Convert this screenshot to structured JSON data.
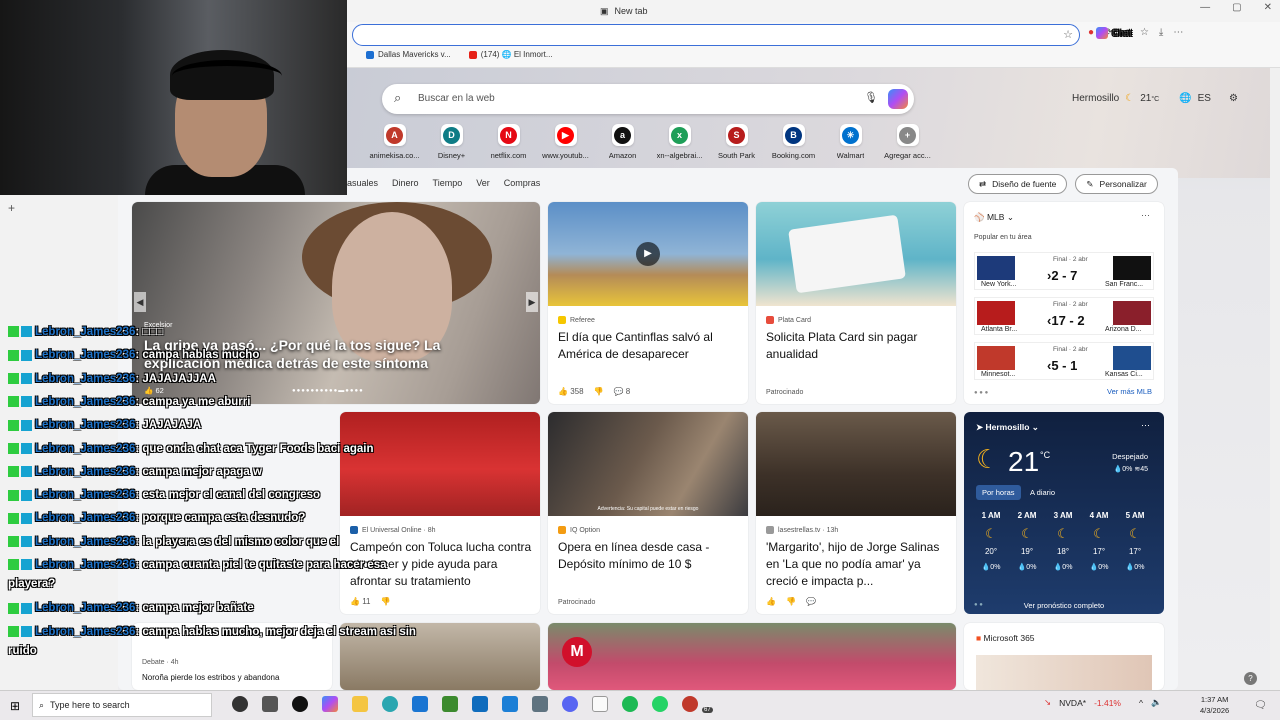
{
  "browser": {
    "tab_title": "New tab",
    "chat_label": "Chat",
    "bookmarks": [
      {
        "label": "Dallas Mavericks v...",
        "color": "#1d6fd1"
      },
      {
        "label": "(174) 🌐 El Inmort...",
        "color": "#e62117"
      }
    ]
  },
  "newtab": {
    "search_placeholder": "Buscar en la web",
    "weather": {
      "city": "Hermosillo",
      "temp": "21",
      "unit": "°C",
      "lang": "ES"
    },
    "quicklinks": [
      {
        "label": "animekisa.co...",
        "letter": "A",
        "color": "#c0392b"
      },
      {
        "label": "Disney+",
        "letter": "D",
        "color": "#0e7c86"
      },
      {
        "label": "netflix.com",
        "letter": "N",
        "color": "#e50914"
      },
      {
        "label": "www.youtub...",
        "letter": "▶",
        "color": "#ff0000"
      },
      {
        "label": "Amazon",
        "letter": "a",
        "color": "#111111"
      },
      {
        "label": "xn--algebrai...",
        "letter": "x",
        "color": "#1e9e58"
      },
      {
        "label": "South Park",
        "letter": "S",
        "color": "#b71c1c"
      },
      {
        "label": "Booking.com",
        "letter": "B",
        "color": "#003580"
      },
      {
        "label": "Walmart",
        "letter": "✳",
        "color": "#0071ce"
      },
      {
        "label": "Agregar acc...",
        "letter": "+",
        "color": "#888888"
      }
    ]
  },
  "feed": {
    "nav": [
      "asuales",
      "Dinero",
      "Tiempo",
      "Ver",
      "Compras"
    ],
    "buttons": {
      "design": "Diseño de fuente",
      "personalize": "Personalizar"
    },
    "hero": {
      "source": "Excelsior",
      "title": "La gripe ya pasó... ¿Por qué la tos sigue? La explicación médica detrás de este síntoma",
      "likes": "62"
    },
    "cards": [
      {
        "source": "Referee",
        "title": "El día que Cantinflas salvó al América de desaparecer",
        "likes": "358",
        "comments": "8",
        "color": "#f6c700"
      },
      {
        "source": "Plata Card",
        "title": "Solicita Plata Card sin pagar anualidad",
        "meta": "Patrocinado",
        "color": "#e74c3c"
      },
      {
        "source": "El Universal Online · 8h",
        "title": "Campeón con Toluca lucha contra el cáncer y pide ayuda para afrontar su tratamiento",
        "likes": "11",
        "color": "#1b5fa8"
      },
      {
        "source": "IQ Option",
        "title": "Opera en línea desde casa - Depósito mínimo de 10 $",
        "meta": "Patrocinado",
        "color": "#f39c12"
      },
      {
        "source": "lasestrellas.tv · 13h",
        "title": "'Margarito', hijo de Jorge Salinas en 'La que no podía amar' ya creció e impacta p...",
        "color": "#999999"
      }
    ],
    "mlb": {
      "title": "MLB",
      "subtitle": "Popular en tu área",
      "games": [
        {
          "status": "Final · 2 abr",
          "home": "New York...",
          "away": "San Franc...",
          "score": "2 - 7",
          "arrow": "›"
        },
        {
          "status": "Final · 2 abr",
          "home": "Atlanta Br...",
          "away": "Arizona D...",
          "score": "17 - 2",
          "arrow": "‹"
        },
        {
          "status": "Final · 2 abr",
          "home": "Minnesot...",
          "away": "Kansas Ci...",
          "score": "5 - 1",
          "arrow": "‹"
        }
      ],
      "more": "Ver más MLB"
    },
    "weather_card": {
      "city": "Hermosillo",
      "temp": "21",
      "unit": "°C",
      "condition": "Despejado",
      "precip": "0%",
      "wind": "45",
      "tabs": [
        "Por horas",
        "A diario"
      ],
      "hours": [
        {
          "time": "1 AM",
          "temp": "20°",
          "rain": "0%"
        },
        {
          "time": "2 AM",
          "temp": "19°",
          "rain": "0%"
        },
        {
          "time": "3 AM",
          "temp": "18°",
          "rain": "0%"
        },
        {
          "time": "4 AM",
          "temp": "17°",
          "rain": "0%"
        },
        {
          "time": "5 AM",
          "temp": "17°",
          "rain": "0%"
        }
      ],
      "forecast_link": "Ver pronóstico completo"
    },
    "ms365": "Microsoft 365",
    "ad_label": "Advertencia: Su capital puede estar en riesgo",
    "bottom_card_source": "Debate · 4h",
    "bottom_card_title": "Noroña pierde los estribos y abandona"
  },
  "chat": [
    {
      "user": "Lebron_James236",
      "msg": ": □□□"
    },
    {
      "user": "Lebron_James236",
      "msg": ": campa hablas mucho"
    },
    {
      "user": "Lebron_James236",
      "msg": ": JAJAJAJJAA"
    },
    {
      "user": "Lebron_James236",
      "msg": ": campa ya me aburri"
    },
    {
      "user": "Lebron_James236",
      "msg": ": JAJAJAJA"
    },
    {
      "user": "Lebron_James236",
      "msg": ": que onda chat aca Tyger Foods baci again"
    },
    {
      "user": "Lebron_James236",
      "msg": ": campa mejor apaga w"
    },
    {
      "user": "Lebron_James236",
      "msg": ": esta mejor el canal del congreso"
    },
    {
      "user": "Lebron_James236",
      "msg": ": porque campa esta desnudo?"
    },
    {
      "user": "Lebron_James236",
      "msg": ": la playera es del mismo color que el"
    },
    {
      "user": "Lebron_James236",
      "msg": ": campa cuanta piel te quitaste para hacer esa",
      "cont": "playera?"
    },
    {
      "user": "Lebron_James236",
      "msg": ": campa mejor bañate"
    },
    {
      "user": "Lebron_James236",
      "msg": ": campa hablas mucho, mejor deja el stream asi sin",
      "cont": "ruido"
    }
  ],
  "taskbar": {
    "search_placeholder": "Type here to search",
    "stock": "NVDA*",
    "stock_change": "-1.41%",
    "time": "1:37 AM",
    "date": "4/3/2026",
    "badge": "67"
  }
}
